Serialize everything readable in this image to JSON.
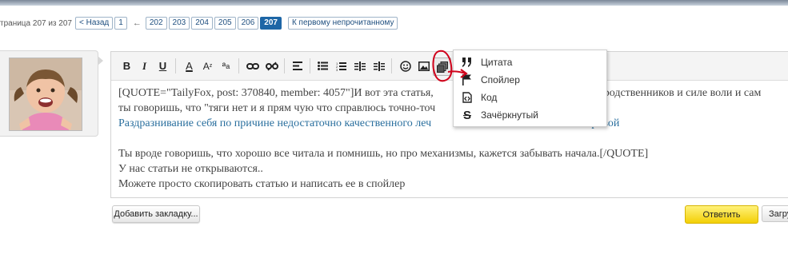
{
  "pagination": {
    "info": "траница 207 из 207",
    "back": "< Назад",
    "first": "1",
    "ellipsis": "←",
    "pages": [
      "202",
      "203",
      "204",
      "205",
      "206"
    ],
    "current": "207",
    "to_unread": "К первому непрочитанному"
  },
  "editor": {
    "lines": [
      "[QUOTE=\"TailyFox, post: 370840, member: 4057\"]И вот эта статья,",
      "ты говоришь, что \"тяги нет и я прям чую что справлюсь точно-точ",
      "Раздразнивание себя по причине недостаточно качественного леч",
      "",
      "Ты вроде говоришь, что хорошо все читала и помнишь, но про механизмы, кажется забывать начала.[/QUOTE]",
      "У нас статьи не открываются..",
      "Можете просто скопировать статью и написать ее в спойлер"
    ],
    "line1_tail": "ния родственников и силе воли и сам",
    "line3_tail": "ты Башаровой",
    "link_color": "#2a6f9e"
  },
  "toolbar": {
    "icons": [
      "bold-icon",
      "italic-icon",
      "underline-icon",
      "font-color-icon",
      "font-size-icon",
      "font-family-icon",
      "link-icon",
      "unlink-icon",
      "align-icon",
      "unordered-list-icon",
      "ordered-list-icon",
      "outdent-icon",
      "indent-icon",
      "smiley-icon",
      "image-icon",
      "insert-media-icon"
    ]
  },
  "dropdown": {
    "items": [
      {
        "icon": "quote-icon",
        "label": "Цитата"
      },
      {
        "icon": "flag-icon",
        "label": "Спойлер"
      },
      {
        "icon": "code-icon",
        "label": "Код"
      },
      {
        "icon": "strike-icon",
        "label": "Зачёркнутый"
      }
    ]
  },
  "buttons": {
    "bookmark": "Добавить закладку...",
    "reply": "Ответить",
    "upload": "Загру"
  },
  "colors": {
    "annotation": "#d0021b",
    "reply_bg": "#f5d50c",
    "page_current": "#1d66a6"
  }
}
